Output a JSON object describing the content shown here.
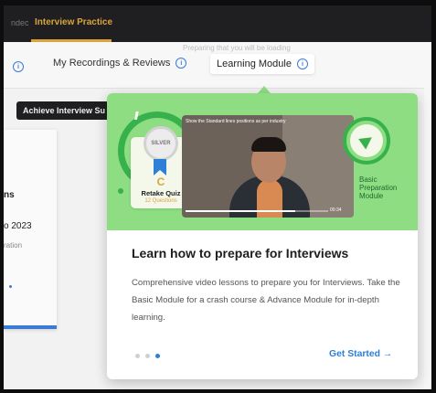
{
  "topbar": {
    "dim_label": "ndec",
    "active_tab": "Interview Practice"
  },
  "subnav": {
    "ghost_text": "Preparing that you will be loading",
    "tabs": [
      {
        "label": "My Recordings & Reviews"
      },
      {
        "label": "Learning Module",
        "active": true
      }
    ]
  },
  "left_panel": {
    "achieve_button": "Achieve Interview Su",
    "card_line_1": "ns",
    "card_line_2": "o 2023",
    "card_line_3": "ration"
  },
  "popup": {
    "banner": {
      "retake_title": "Retake Quiz",
      "retake_count": "12 Questions",
      "medal_text": "SILVER",
      "video_caption": "Show the Standard lines positions as per industry",
      "video_time": "00:34",
      "basic_label_lines": [
        "Basic",
        "Preparation",
        "Module"
      ]
    },
    "heading": "Learn how to prepare for Interviews",
    "description": "Comprehensive video lessons to prepare you for Interviews. Take the Basic Module for a crash course & Advance Module for in-depth learning.",
    "pagination": {
      "total": 3,
      "active_index": 2
    },
    "cta_label": "Get Started →"
  },
  "colors": {
    "accent_gold": "#d9a43a",
    "banner_green": "#8edd83",
    "ring_green": "#36b14b",
    "link_blue": "#2e7fd6"
  },
  "icons": [
    "info-icon",
    "retry-icon",
    "send-icon",
    "arrow-right-icon"
  ]
}
